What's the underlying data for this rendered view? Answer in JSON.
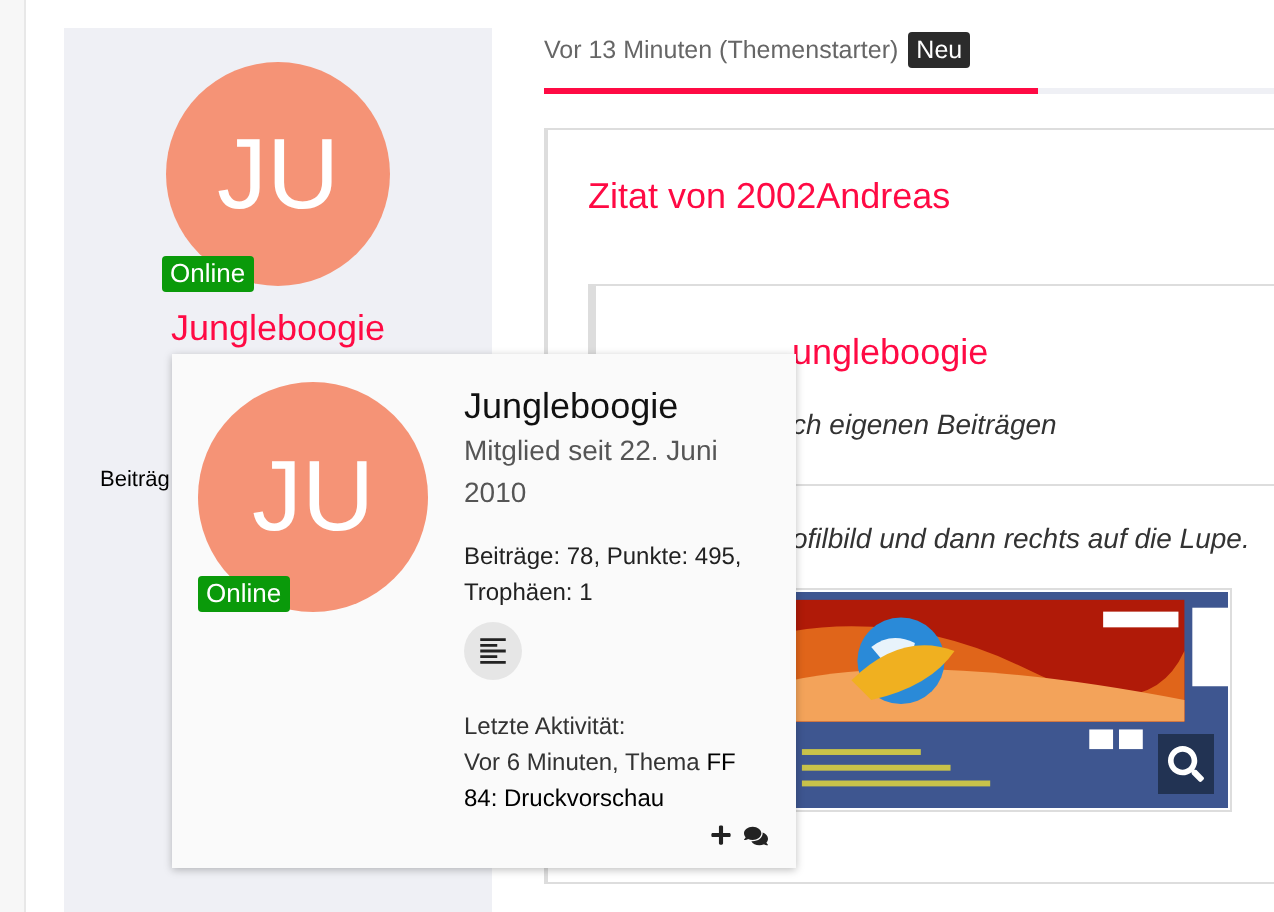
{
  "sidebar": {
    "initials": "JU",
    "status": {
      "label": "Online",
      "online": true
    },
    "username": "Jungleboogie",
    "stats_label": "Beiträg"
  },
  "post": {
    "meta": "Vor 13 Minuten (Themenstarter)",
    "badge": "Neu",
    "progress": {
      "level": 0.65
    }
  },
  "quote": {
    "title": "Zitat von 2002Andreas",
    "nested": {
      "title": "ungleboogie",
      "text": "ch eigenen Beiträgen"
    },
    "text": "ofilbild und dann rechts auf die Lupe."
  },
  "popup": {
    "initials": "JU",
    "status": {
      "label": "Online",
      "online": true
    },
    "name": "Jungleboogie",
    "member_since": "Mitglied seit 22. Juni 2010",
    "stats": "Beiträge: 78, Punkte: 495, Trophäen: 1",
    "activity_label": "Letzte Aktivität:",
    "activity": "Vor 6 Minuten, Thema **FF 84: Druckvorschau**"
  }
}
